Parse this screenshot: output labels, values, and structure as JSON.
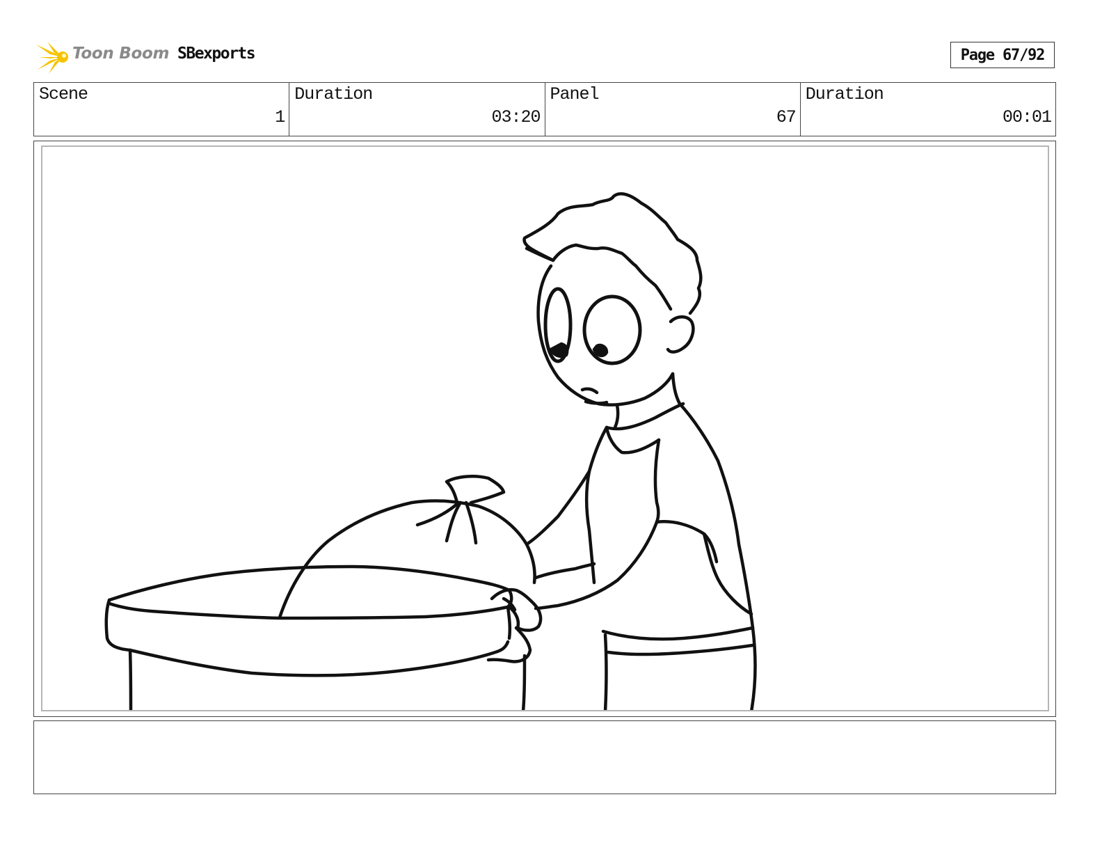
{
  "header": {
    "logo_text": "Toon Boom",
    "project_name": "SBexports",
    "page_label": "Page 67/92"
  },
  "info_bar": [
    {
      "label": "Scene",
      "value": "1"
    },
    {
      "label": "Duration",
      "value": "03:20"
    },
    {
      "label": "Panel",
      "value": "67"
    },
    {
      "label": "Duration",
      "value": "00:01"
    }
  ],
  "panel_image": {
    "description_icon": "storyboard-sketch-boy-trash-bag-icon"
  },
  "notes": {
    "text": ""
  },
  "colors": {
    "logo_star": "#f5c400",
    "logo_text": "#8a8a8a",
    "frame_border": "#b5b5b5"
  }
}
